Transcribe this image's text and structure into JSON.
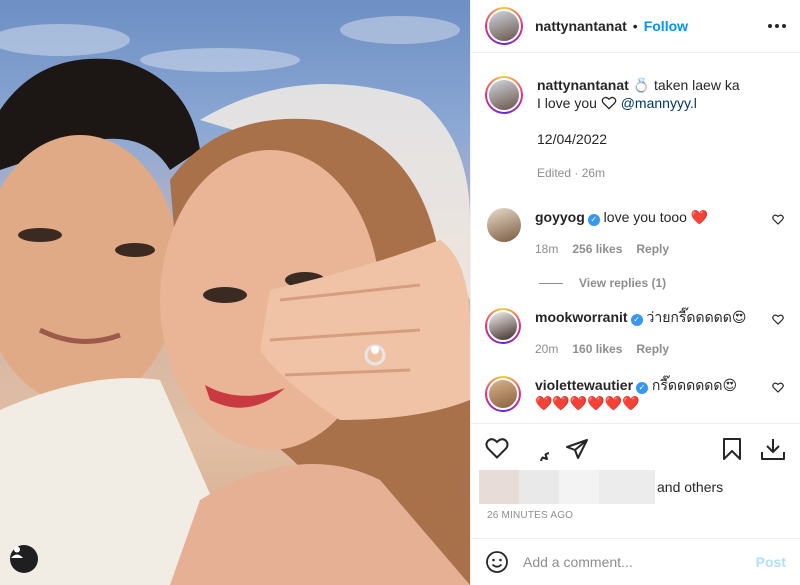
{
  "post": {
    "username": "nattynantanat",
    "follow_label": "Follow",
    "separator": "•",
    "caption_line1": "taken laew ka",
    "caption_ring_emoji": "💍",
    "caption_line2_prefix": "I love you",
    "caption_mention": "@mannyyy.l",
    "caption_date": "12/04/2022",
    "edited": "Edited · 26m"
  },
  "comments": [
    {
      "username": "goyyog",
      "verified": true,
      "text": "love you tooo",
      "emoji": "❤️",
      "time": "18m",
      "likes": "256 likes",
      "reply": "Reply"
    },
    {
      "username": "mookworranit",
      "verified": true,
      "text": "ว่ายกรี๊ดดดดด",
      "emoji": "😍",
      "time": "20m",
      "likes": "160 likes",
      "reply": "Reply"
    },
    {
      "username": "violettewautier",
      "verified": true,
      "text": "กรี๊ดดดดดด",
      "emoji": "😍",
      "line2": "❤️❤️❤️❤️❤️❤️"
    }
  ],
  "view_replies": "View replies (1)",
  "likes": {
    "text": "and others"
  },
  "timestamp": "26 MINUTES AGO",
  "add_comment": {
    "placeholder": "Add a comment...",
    "post_label": "Post"
  },
  "colors": {
    "accent": "#0095f6",
    "muted": "#8e8e8e",
    "heart": "#ed4956"
  },
  "icons": [
    "more-icon",
    "heart-icon",
    "comment-icon",
    "share-icon",
    "bookmark-icon",
    "download-icon",
    "emoji-icon",
    "user-tag-icon",
    "verified-icon",
    "ring-icon"
  ]
}
